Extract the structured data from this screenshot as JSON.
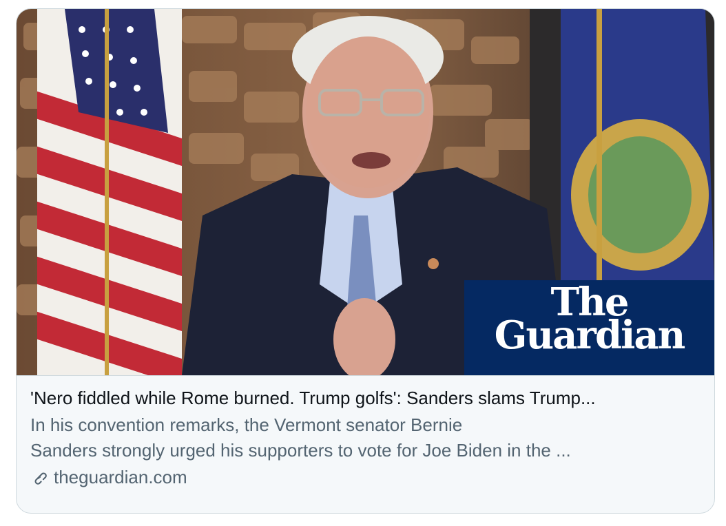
{
  "card": {
    "headline": "'Nero fiddled while Rome burned. Trump golfs': Sanders slams Trump...",
    "description_line1": "In his convention remarks, the Vermont senator Bernie",
    "description_line2": "Sanders strongly urged his supporters to vote for Joe Biden in the ...",
    "domain": "theguardian.com",
    "link_icon": "link-icon"
  },
  "media": {
    "logo_line1": "The",
    "logo_line2": "Guardian",
    "logo_background": "#052962"
  },
  "colors": {
    "card_background": "#f5f8fa",
    "card_border": "#cfd9de",
    "headline_text": "#0f1419",
    "secondary_text": "#536471"
  }
}
